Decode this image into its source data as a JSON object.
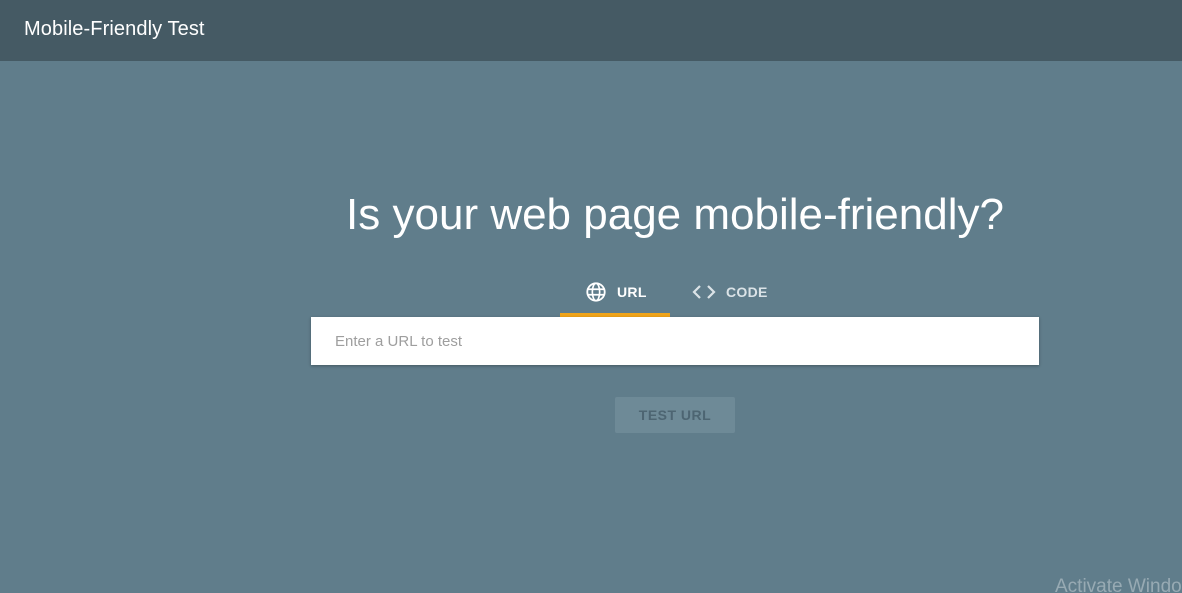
{
  "header": {
    "title": "Mobile-Friendly Test"
  },
  "main": {
    "headline": "Is your web page mobile-friendly?",
    "tabs": [
      {
        "label": "URL",
        "icon": "globe-icon",
        "active": true
      },
      {
        "label": "CODE",
        "icon": "code-icon",
        "active": false
      }
    ],
    "url_input": {
      "placeholder": "Enter a URL to test",
      "value": ""
    },
    "test_button_label": "TEST URL"
  },
  "watermark": {
    "text": "Activate Windo"
  },
  "colors": {
    "header_bg": "#455a64",
    "page_bg": "#607d8b",
    "tab_indicator": "#f0a41a"
  }
}
